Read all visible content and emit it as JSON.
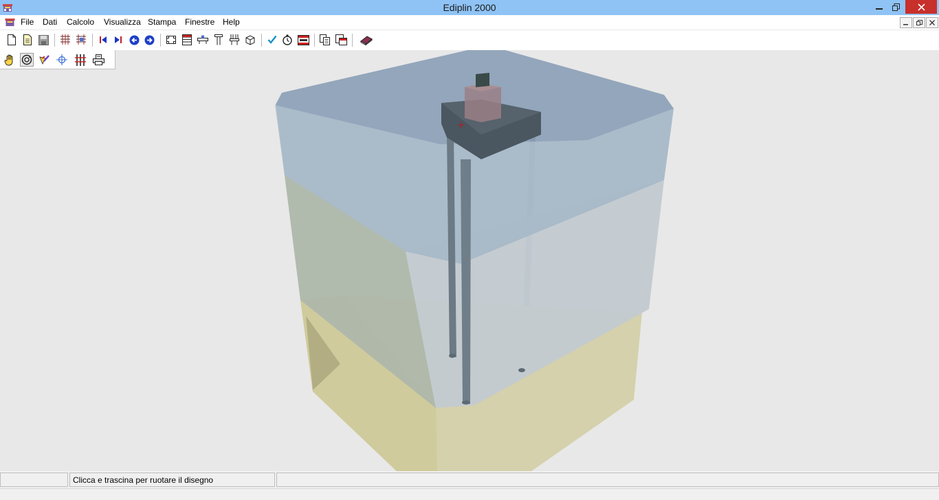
{
  "window": {
    "title": "Ediplin 2000"
  },
  "menu": [
    "File",
    "Dati",
    "Calcolo",
    "Visualizza",
    "Stampa",
    "Finestre",
    "Help"
  ],
  "toolbar1": [
    "new-file-icon",
    "open-file-icon",
    "save-icon",
    "layers-icon",
    "layers-edit-icon",
    "first-record-icon",
    "last-record-icon",
    "previous-icon",
    "next-icon",
    "frame-icon",
    "table-icon",
    "cap-icon",
    "pile-icon",
    "section-icon",
    "cube-icon",
    "check-icon",
    "timer-icon",
    "results-icon",
    "copy-icon",
    "print-preview-icon",
    "book-icon"
  ],
  "toolbar2": [
    "hand-pan-icon",
    "rotate-icon",
    "paint-icon",
    "center-icon",
    "columns-icon",
    "printer-icon"
  ],
  "status": {
    "pane1": "",
    "pane2": "Clicca e trascina per ruotare il disegno",
    "pane3": ""
  },
  "colors": {
    "titlebar": "#8fc3f5",
    "close_button": "#c7302b",
    "soil_top": "#7f98b2",
    "soil_middle": "#b4c2cc",
    "soil_bottom": "#d3d0a9",
    "pile": "#6b7a84",
    "pile_cap": "#4a5660",
    "column": "#9a7f86"
  }
}
